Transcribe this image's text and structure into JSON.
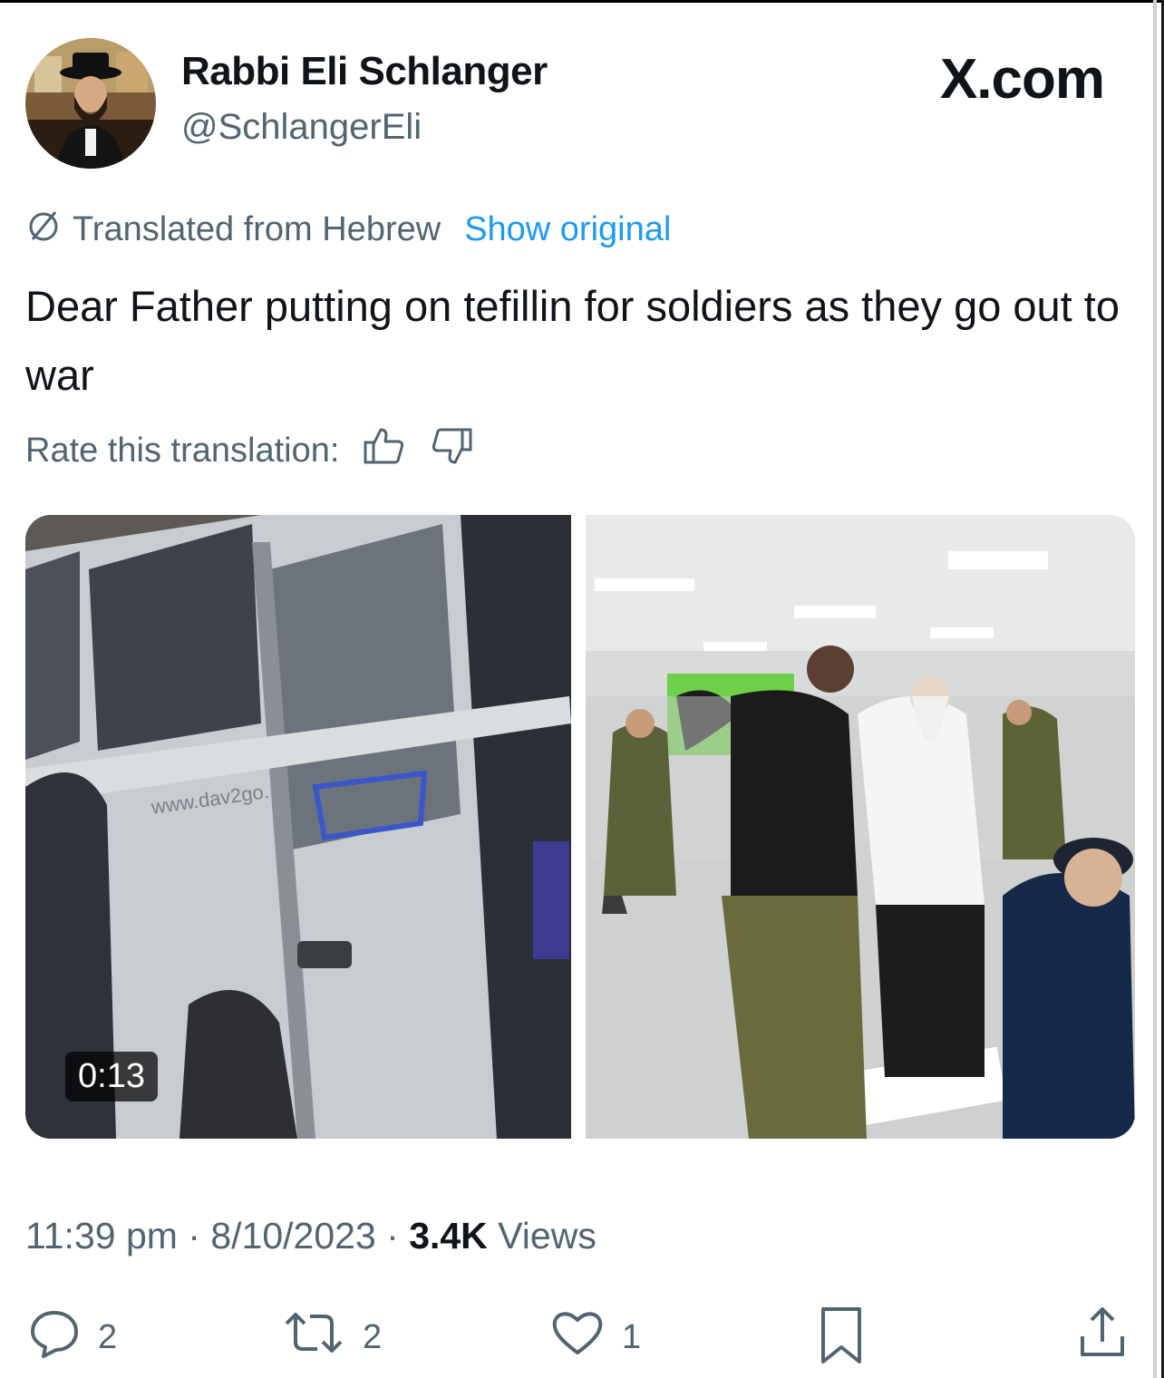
{
  "author": {
    "name": "Rabbi Eli Schlanger",
    "handle": "@SchlangerEli"
  },
  "brand": "X.com",
  "translation": {
    "label": "Translated from Hebrew",
    "show_original": "Show original",
    "rate_label": "Rate this translation:"
  },
  "tweet": {
    "text": "Dear Father putting on tefillin for soldiers as they go out to war"
  },
  "media": {
    "video_duration": "0:13"
  },
  "meta": {
    "time": "11:39 pm",
    "separator": " · ",
    "date": "8/10/2023",
    "views_count": "3.4K",
    "views_label": "Views"
  },
  "actions": {
    "replies": "2",
    "reposts": "2",
    "likes": "1"
  },
  "icons": [
    "translate-icon",
    "thumbs-up-icon",
    "thumbs-down-icon",
    "reply-icon",
    "repost-icon",
    "like-icon",
    "bookmark-icon",
    "share-icon"
  ],
  "colors": {
    "link": "#1d9bf0",
    "secondary_text": "#536471",
    "primary_text": "#0f1419"
  }
}
